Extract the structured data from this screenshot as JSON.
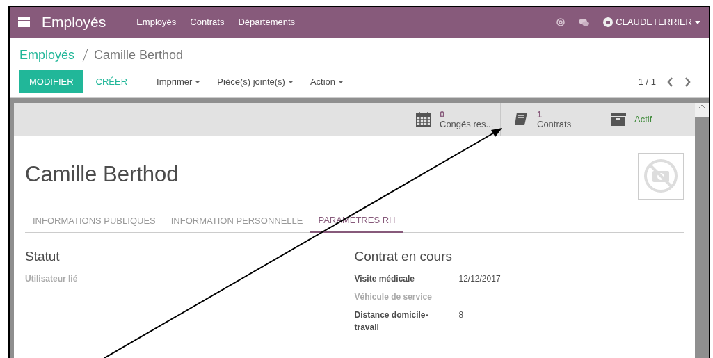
{
  "navbar": {
    "app_title": "Employés",
    "menu": [
      "Employés",
      "Contrats",
      "Départements"
    ],
    "user": "CLAUDETERRIER"
  },
  "control_panel": {
    "breadcrumb": [
      "Employés",
      "Camille Berthod"
    ],
    "buttons": [
      {
        "label": "MODIFIER",
        "kind": "primary"
      },
      {
        "label": "CRÉER",
        "kind": "link"
      }
    ],
    "dropdowns": [
      "Imprimer",
      "Pièce(s) jointe(s)",
      "Action"
    ],
    "pager": "1 / 1"
  },
  "stat_buttons": [
    {
      "kind": "calendar",
      "value": "0",
      "label": "Congés res..."
    },
    {
      "kind": "book",
      "value": "1",
      "label": "Contrats"
    },
    {
      "kind": "archive",
      "label": "Actif"
    }
  ],
  "employee_name": "Camille Berthod",
  "tabs": [
    {
      "label": "INFORMATIONS PUBLIQUES",
      "selected": false
    },
    {
      "label": "INFORMATION PERSONNELLE",
      "selected": false
    },
    {
      "label": "PARAMÈTRES RH",
      "selected": true
    }
  ],
  "groups": [
    {
      "title": "Statut",
      "fields": [
        {
          "label": "Utilisateur lié",
          "empty": true
        }
      ]
    },
    {
      "title": "Contrat en cours",
      "fields": [
        {
          "label": "Visite médicale",
          "value": "12/12/2017",
          "empty": false
        },
        {
          "label": "Véhicule de service",
          "empty": true
        },
        {
          "label": "Distance domicile-travail",
          "value": "8",
          "empty": false
        }
      ]
    }
  ]
}
